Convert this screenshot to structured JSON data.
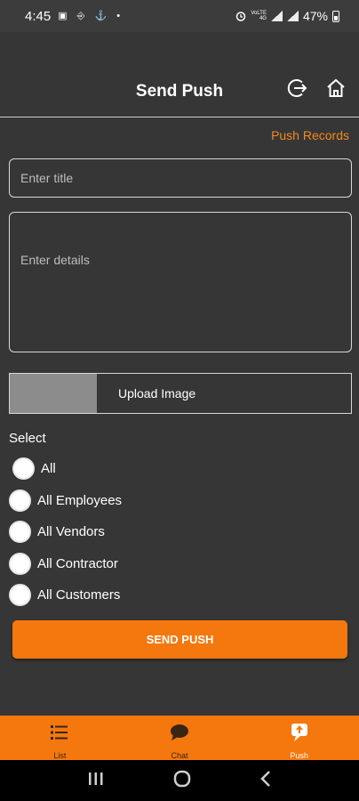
{
  "status_bar": {
    "time": "4:45",
    "notification_icons": "▣ ⎆ ⚓ •",
    "network_text_top": "VoLTE",
    "network_text_bottom": "4G",
    "battery": "47%"
  },
  "header": {
    "title": "Send Push",
    "logout_icon": "logout-icon",
    "home_icon": "home-icon"
  },
  "push_records_link": "Push Records",
  "form": {
    "title_placeholder": "Enter title",
    "details_placeholder": "Enter details",
    "upload_label": "Upload Image",
    "select_label": "Select",
    "options": [
      {
        "label": "All",
        "selected": false
      },
      {
        "label": "All Employees",
        "selected": false
      },
      {
        "label": "All Vendors",
        "selected": false
      },
      {
        "label": "All Contractor",
        "selected": false
      },
      {
        "label": "All Customers",
        "selected": false
      }
    ],
    "submit_label": "SEND PUSH"
  },
  "bottom_nav": {
    "items": [
      {
        "label": "List",
        "icon": "list-icon",
        "active": false
      },
      {
        "label": "Chat",
        "icon": "chat-icon",
        "active": false
      },
      {
        "label": "Push",
        "icon": "push-icon",
        "active": true
      }
    ]
  },
  "colors": {
    "accent": "#f4780d",
    "link": "#f28a1c",
    "background": "#363636"
  }
}
